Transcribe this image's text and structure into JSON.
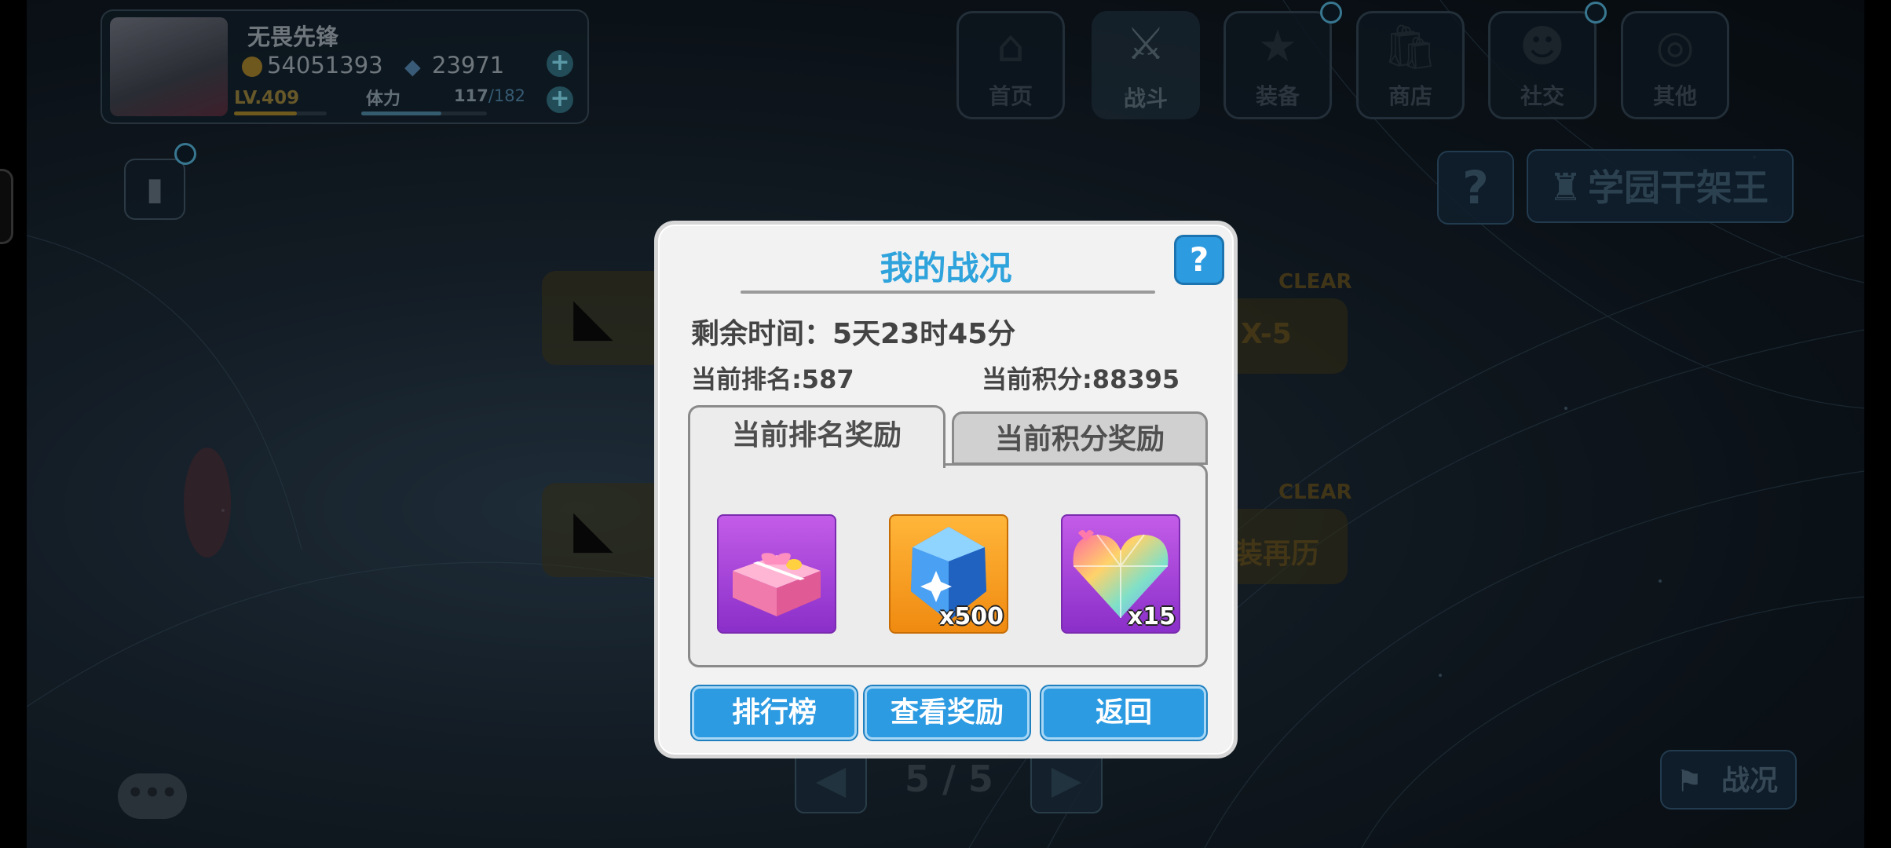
{
  "player": {
    "name": "无畏先锋",
    "coins": "54051393",
    "gems": "23971",
    "level": "LV.409",
    "stamina_label": "体力",
    "stamina_current": "117",
    "stamina_max": "/182",
    "level_progress": 0.68,
    "stamina_progress": 0.64
  },
  "nav": [
    {
      "label": "首页",
      "icon": "home-icon"
    },
    {
      "label": "战斗",
      "icon": "battle-icon"
    },
    {
      "label": "装备",
      "icon": "equipment-icon"
    },
    {
      "label": "商店",
      "icon": "shop-icon"
    },
    {
      "label": "社交",
      "icon": "social-icon"
    },
    {
      "label": "其他",
      "icon": "other-icon"
    }
  ],
  "mode": {
    "help": "?",
    "title": "学园干架王"
  },
  "stages": [
    {
      "clear": "CLEAR",
      "label": "X-5"
    },
    {
      "clear": "CLEAR",
      "label": "装再历"
    }
  ],
  "pager": {
    "text": "5 / 5"
  },
  "battle_status_button": "战况",
  "dialog": {
    "title": "我的战况",
    "help": "?",
    "time_remaining": "剩余时间：5天23时45分",
    "rank": "当前排名:587",
    "score": "当前积分:88395",
    "tabs": [
      "当前排名奖励",
      "当前积分奖励"
    ],
    "rewards": [
      {
        "icon": "gift-box-icon",
        "qty": ""
      },
      {
        "icon": "blue-crystal-icon",
        "qty": "x500"
      },
      {
        "icon": "rainbow-heart-gem-icon",
        "qty": "x15"
      }
    ],
    "buttons": {
      "leaderboard": "排行榜",
      "view_rewards": "查看奖励",
      "back": "返回"
    }
  },
  "colors": {
    "accent": "#2ea3dc",
    "button": "#2c9be2",
    "reward_purple": "#a845dc",
    "reward_orange": "#f7a023"
  }
}
